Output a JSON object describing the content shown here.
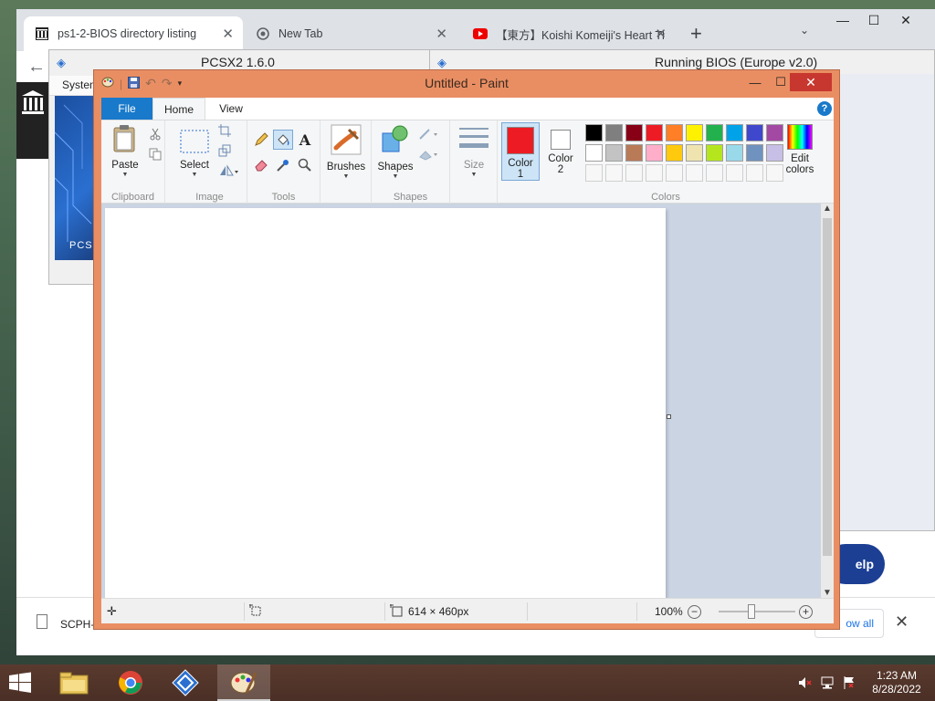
{
  "chrome": {
    "tabs": [
      {
        "title": "ps1-2-BIOS directory listing"
      },
      {
        "title": "New Tab"
      },
      {
        "title": "【東方】Koishi Komeiji's Heart Th"
      }
    ],
    "download": {
      "file": "SCPH-",
      "show_all": "ow all"
    },
    "help_label": "elp"
  },
  "pcsx2": {
    "title": "PCSX2  1.6.0",
    "menu": "System",
    "art_label": "PCSX"
  },
  "running": {
    "title": "Running BIOS (Europe v2.0)"
  },
  "paint": {
    "title": "Untitled - Paint",
    "tabs": {
      "file": "File",
      "home": "Home",
      "view": "View"
    },
    "groups": {
      "clipboard": "Clipboard",
      "image": "Image",
      "tools": "Tools",
      "shapes": "Shapes",
      "colors": "Colors"
    },
    "buttons": {
      "paste": "Paste",
      "select": "Select",
      "brushes": "Brushes",
      "shapes": "Shapes",
      "size": "Size",
      "color1_line1": "Color",
      "color1_line2": "1",
      "color2_line1": "Color",
      "color2_line2": "2",
      "edit_line1": "Edit",
      "edit_line2": "colors"
    },
    "palette": {
      "row1": [
        "#000000",
        "#7f7f7f",
        "#880015",
        "#ed1c24",
        "#ff7f27",
        "#fff200",
        "#22b14c",
        "#00a2e8",
        "#3f48cc",
        "#a349a4"
      ],
      "row2": [
        "#ffffff",
        "#c3c3c3",
        "#b97a57",
        "#ffaec9",
        "#ffc90e",
        "#efe4b0",
        "#b5e61d",
        "#99d9ea",
        "#7092be",
        "#c8bfe7"
      ]
    },
    "color1": "#ed1c24",
    "color2": "#ffffff",
    "status": {
      "size": "614 × 460px",
      "zoom": "100%"
    }
  },
  "taskbar": {
    "time": "1:23 AM",
    "date": "8/28/2022"
  }
}
